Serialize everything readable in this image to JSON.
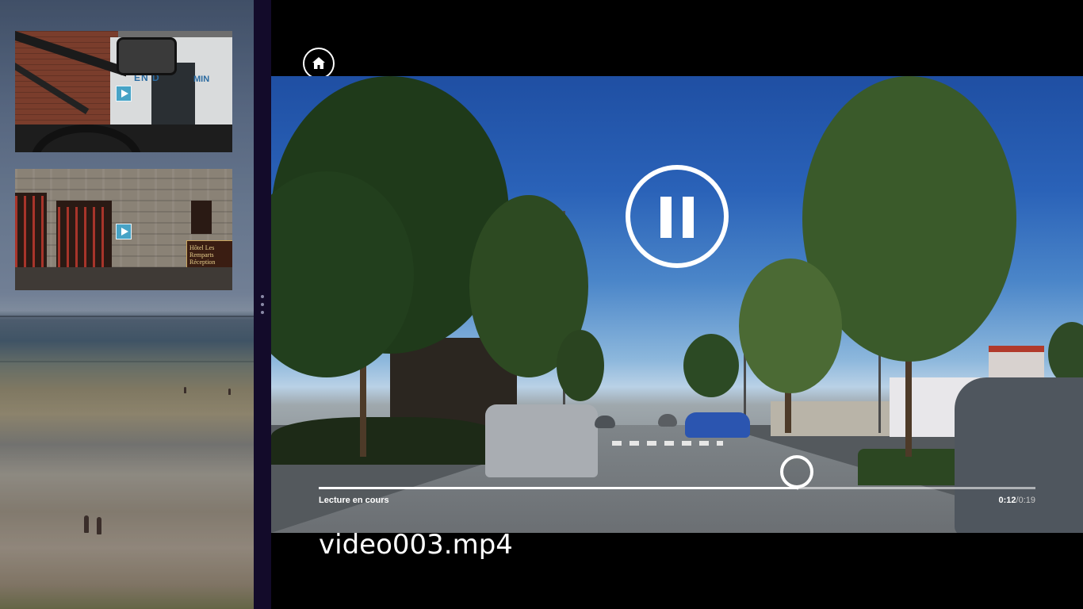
{
  "player": {
    "title": "video003.mp4",
    "status": "Lecture en cours",
    "time_current": "0:12",
    "time_separator": "/",
    "time_total": "0:19",
    "progress_fraction": 0.6667,
    "state": "playing"
  },
  "icons": {
    "home": "home-icon",
    "pause": "pause-icon",
    "play_badge": "play-icon"
  },
  "playlist": {
    "items": [
      {
        "type": "video",
        "scene": "garage seen from car"
      },
      {
        "type": "video",
        "scene": "stone hotel building"
      }
    ]
  },
  "thumb2_sign": "Hôtel Les Remparts Réception",
  "colors": {
    "splitter": "#130b2a",
    "play_badge": "#47a3c6",
    "background": "#000000",
    "text": "#ffffff"
  }
}
